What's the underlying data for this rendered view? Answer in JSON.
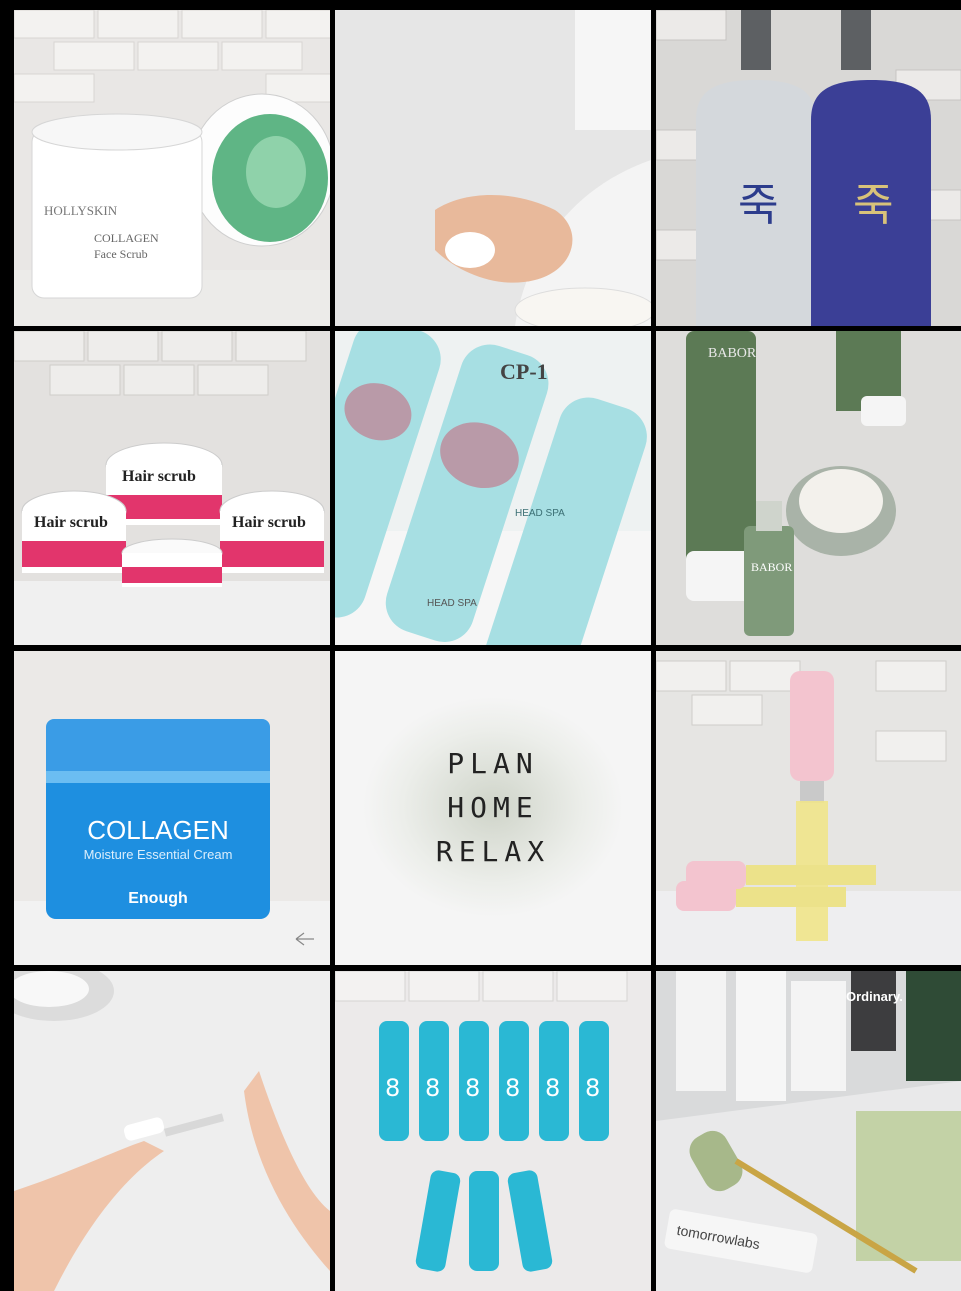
{
  "tiles": [
    {
      "id": "hollyskin-collagen-face-scrub",
      "labels": [
        "HOLLYSKIN",
        "COLLAGEN",
        "Face Scrub"
      ]
    },
    {
      "id": "hand-with-cream",
      "labels": []
    },
    {
      "id": "daeng-gi-meo-ri-shampoos",
      "labels": []
    },
    {
      "id": "hair-scrub-jars",
      "labels": [
        "Hair scrub",
        "Hair scrub",
        "Hair scrub"
      ]
    },
    {
      "id": "cp1-head-spa",
      "labels": [
        "CP-1",
        "HEAD SPA",
        "HEAD SPA"
      ]
    },
    {
      "id": "babor-products",
      "labels": [
        "BABOR",
        "BABOR"
      ]
    },
    {
      "id": "enough-collagen-cream",
      "labels": [
        "COLLAGEN",
        "Moisture Essential Cream",
        "Enough"
      ]
    },
    {
      "id": "plan-home-relax",
      "labels": [
        "PLAN",
        "HOME",
        "RELAX"
      ]
    },
    {
      "id": "hair-oil-ampoules",
      "labels": []
    },
    {
      "id": "hands-with-dropper",
      "labels": []
    },
    {
      "id": "masil-hair-ampoules",
      "labels": [
        "8",
        "8",
        "8",
        "8",
        "8",
        "8"
      ]
    },
    {
      "id": "tomorrowlabs-jade-roller",
      "labels": [
        "Ordinary.",
        "tomorrowlabs"
      ]
    }
  ],
  "colors": {
    "background": "#000000",
    "enough_blue": "#1e8fe0",
    "pink": "#e2356c",
    "green_tube": "#5c7a55",
    "aqua": "#2ab8d4"
  }
}
